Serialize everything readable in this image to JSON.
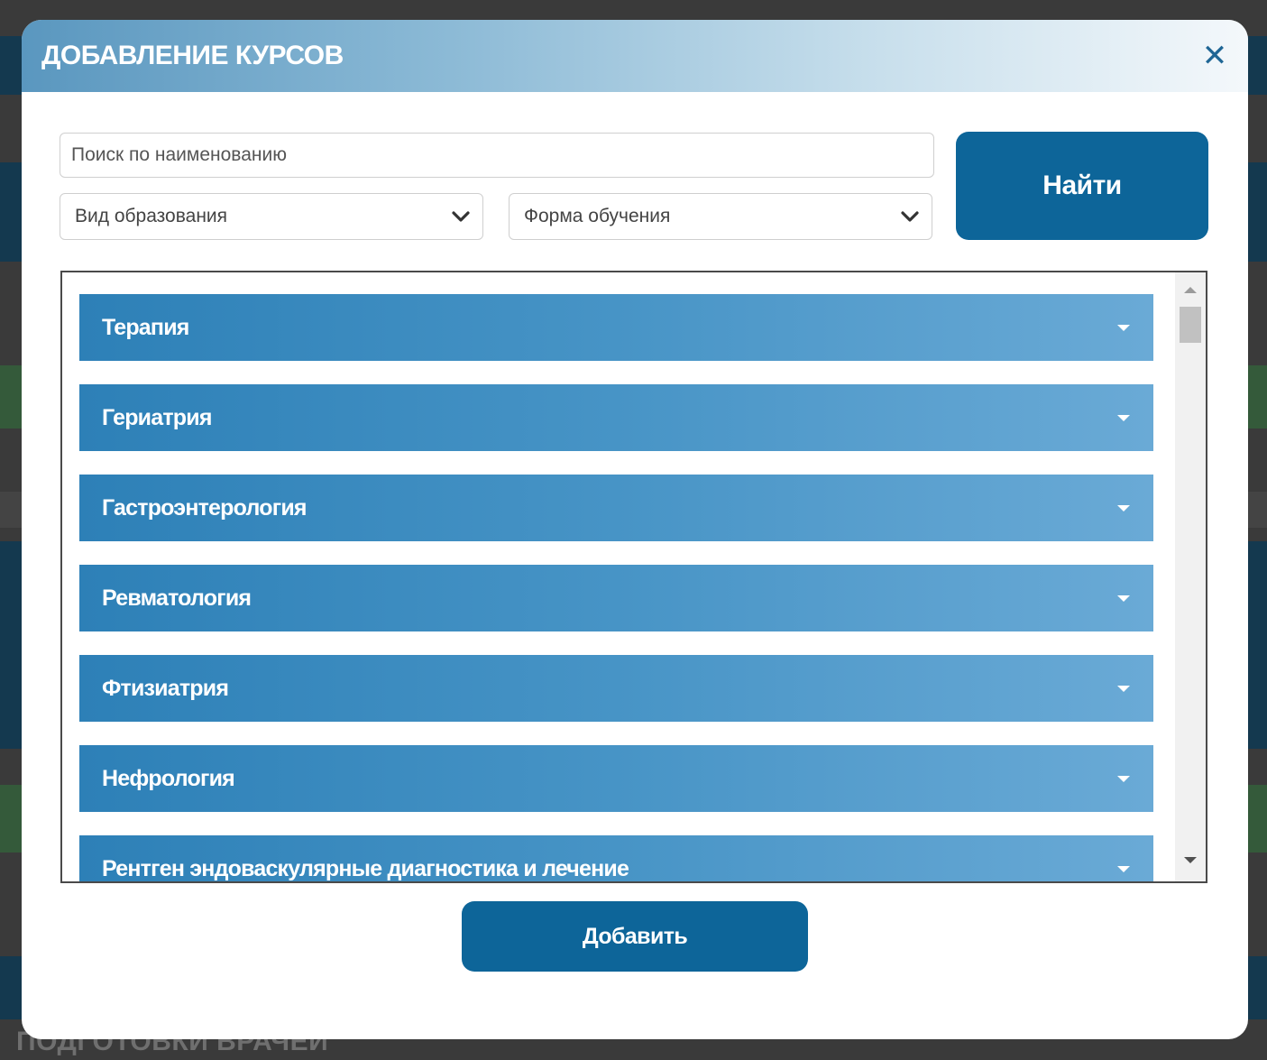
{
  "background": {
    "footer_text": "ПОДГОТОВКИ ВРАЧЕЙ"
  },
  "modal": {
    "title": "ДОБАВЛЕНИЕ КУРСОВ",
    "close_icon": "close-icon",
    "search": {
      "placeholder": "Поиск по наименованию",
      "value": ""
    },
    "filters": {
      "education_type": "Вид образования",
      "study_form": "Форма обучения"
    },
    "find_label": "Найти",
    "add_label": "Добавить",
    "courses": [
      "Терапия",
      "Гериатрия",
      "Гастроэнтерология",
      "Ревматология",
      "Фтизиатрия",
      "Нефрология",
      "Рентген эндоваскулярные диагностика и лечение"
    ]
  },
  "colors": {
    "primary": "#0d6599",
    "accordion_start": "#2d80b7",
    "accordion_end": "#6aaad6"
  }
}
